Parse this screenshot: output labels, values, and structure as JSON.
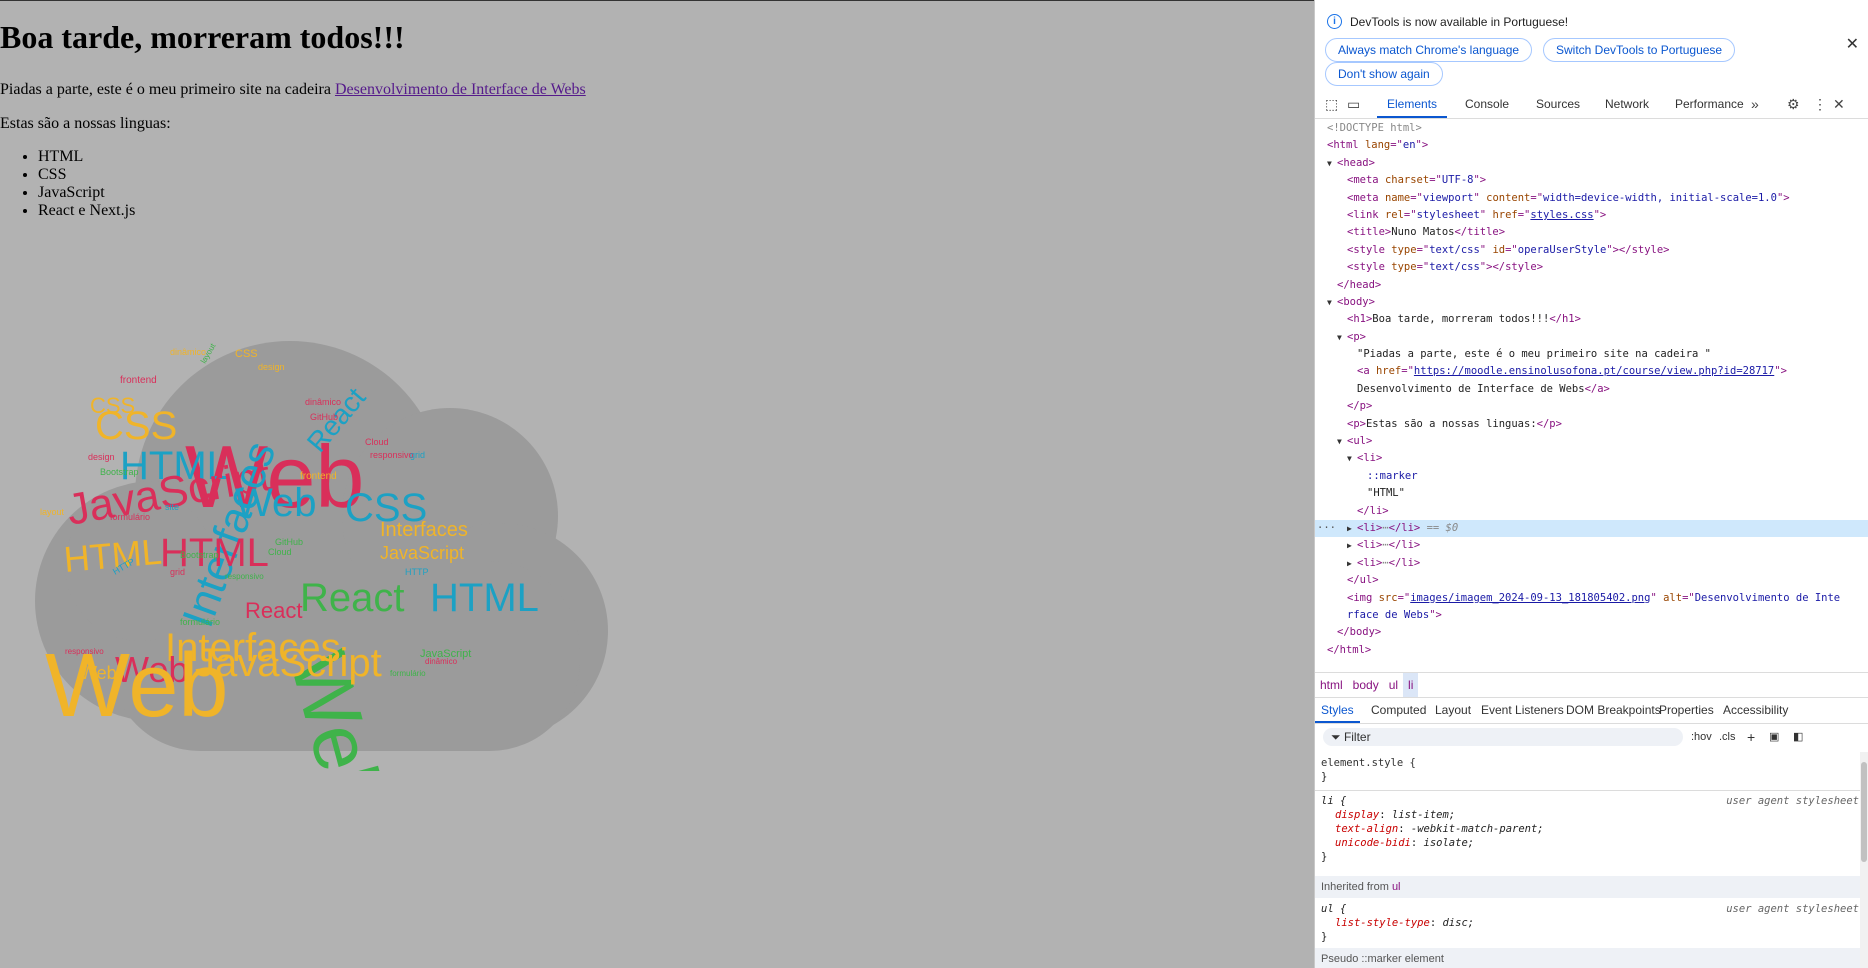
{
  "page": {
    "heading": "Boa tarde, morreram todos!!!",
    "intro_text": "Piadas a parte, este é o meu primeiro site na cadeira ",
    "intro_link": "Desenvolvimento de Interface de Webs",
    "languages_intro": "Estas são a nossas linguas:",
    "languages": [
      "HTML",
      "CSS",
      "JavaScript",
      "React e Next.js"
    ],
    "wordcloud": {
      "alt": "Desenvolvimento de Interface de Webs",
      "cloud_color": "#999999",
      "words": [
        "Web",
        "CSS",
        "HTML",
        "JavaScript",
        "Interfaces",
        "React",
        "Web",
        "HTML",
        "CSS",
        "React",
        "Web",
        "JavaScript",
        "Interfaces",
        "HTML",
        "CSS",
        "React",
        "JavaScript",
        "Web",
        "HTML",
        "Interfaces",
        "Web",
        "frontend",
        "dinâmico",
        "design",
        "CSS",
        "layout",
        "GitHub",
        "Cloud",
        "responsivo",
        "grid",
        "Bootstrap",
        "HTTP",
        "formulário",
        "site",
        "frontend",
        "Bootstrap",
        "design",
        "dinâmico",
        "GitHub",
        "Cloud",
        "layout",
        "responsivo",
        "grid",
        "HTTP",
        "formulário",
        "JavaScript",
        "dinâmico",
        "formulário",
        "responsivo",
        "Web"
      ]
    }
  },
  "devtools": {
    "infobar": {
      "message": "DevTools is now available in Portuguese!",
      "buttons": [
        "Always match Chrome's language",
        "Switch DevTools to Portuguese",
        "Don't show again"
      ]
    },
    "tabs": [
      "Elements",
      "Console",
      "Sources",
      "Network",
      "Performance"
    ],
    "active_tab": "Elements",
    "dom": {
      "doctype": "<!DOCTYPE html>",
      "html_lang": "en",
      "meta_charset": "UTF-8",
      "meta_viewport_name": "viewport",
      "meta_viewport_content": "width=device-width, initial-scale=1.0",
      "link_rel": "stylesheet",
      "link_href": "styles.css",
      "title": "Nuno Matos",
      "style1_type": "text/css",
      "style1_id": "operaUserStyle",
      "style2_type": "text/css",
      "h1_text": "Boa tarde, morreram todos!!!",
      "p_text": "\"Piadas a parte, este é o meu primeiro site na cadeira \"",
      "a_href": "https://moodle.ensinolusofona.pt/course/view.php?id=28717",
      "a_text": "Desenvolvimento de Interface de Webs",
      "p2_text": "Estas são a nossas linguas:",
      "marker": "::marker",
      "li_text": "\"HTML\"",
      "selected_suffix": "== $0",
      "img_src": "images/imagem_2024-09-13_181805402.png",
      "img_alt_1": "Desenvolvimento de Inte",
      "img_alt_2": "rface de Webs"
    },
    "breadcrumbs": [
      "html",
      "body",
      "ul",
      "li"
    ],
    "styles_tabs": [
      "Styles",
      "Computed",
      "Layout",
      "Event Listeners",
      "DOM Breakpoints",
      "Properties",
      "Accessibility"
    ],
    "filter_placeholder": "Filter",
    "filter_hov": ":hov",
    "filter_cls": ".cls",
    "rules": {
      "element_style": "element.style {",
      "li_selector": "li {",
      "ua_label": "user agent stylesheet",
      "li_props": [
        {
          "name": "display",
          "value": "list-item;"
        },
        {
          "name": "text-align",
          "value": "-webkit-match-parent;"
        },
        {
          "name": "unicode-bidi",
          "value": "isolate;"
        }
      ],
      "inherited_label": "Inherited from",
      "inherited_from": "ul",
      "ul_selector": "ul {",
      "ul_props": [
        {
          "name": "list-style-type",
          "value": "disc;"
        }
      ],
      "pseudo_label": "Pseudo ::marker element",
      "close_brace": "}"
    }
  }
}
